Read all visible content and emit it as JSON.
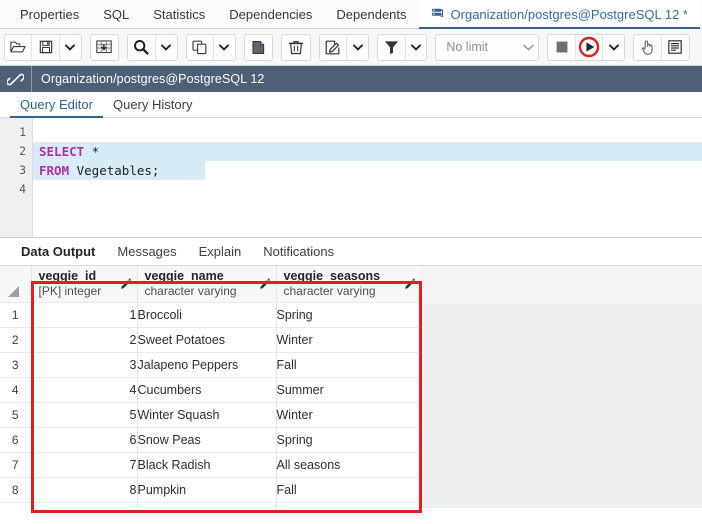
{
  "object_tabs": [
    {
      "label": "Properties",
      "icon": "",
      "active": false
    },
    {
      "label": "SQL",
      "icon": "",
      "active": false
    },
    {
      "label": "Statistics",
      "icon": "",
      "active": false
    },
    {
      "label": "Dependencies",
      "icon": "",
      "active": false
    },
    {
      "label": "Dependents",
      "icon": "",
      "active": false
    },
    {
      "label": "Organization/postgres@PostgreSQL 12 *",
      "icon": "database-icon",
      "active": true
    }
  ],
  "toolbar": {
    "groups": [
      {
        "buttons": [
          {
            "name": "open-file-button",
            "icon": "open-folder-icon",
            "title": "Open File"
          },
          {
            "name": "save-file-button",
            "icon": "save-floppy-icon",
            "title": "Save File"
          },
          {
            "name": "save-dropdown-button",
            "icon": "chevron-down-icon",
            "title": "Save options"
          }
        ]
      },
      {
        "buttons": [
          {
            "name": "edit-grid-button",
            "icon": "grid-download-icon",
            "title": "Edit grid"
          }
        ]
      },
      {
        "buttons": [
          {
            "name": "find-button",
            "icon": "search-icon",
            "title": "Find"
          },
          {
            "name": "find-dropdown-button",
            "icon": "chevron-down-icon",
            "title": "Find options"
          }
        ]
      },
      {
        "buttons": [
          {
            "name": "copy-button",
            "icon": "copy-icon",
            "title": "Copy"
          },
          {
            "name": "copy-dropdown-button",
            "icon": "chevron-down-icon",
            "title": "Copy options"
          }
        ]
      },
      {
        "buttons": [
          {
            "name": "paste-button",
            "icon": "paste-icon",
            "title": "Paste"
          }
        ]
      },
      {
        "buttons": [
          {
            "name": "delete-button",
            "icon": "trash-icon",
            "title": "Delete"
          }
        ]
      },
      {
        "buttons": [
          {
            "name": "edit-button",
            "icon": "pencil-square-icon",
            "title": "Edit"
          },
          {
            "name": "edit-dropdown-button",
            "icon": "chevron-down-icon",
            "title": "Edit options"
          }
        ]
      },
      {
        "buttons": [
          {
            "name": "filter-button",
            "icon": "funnel-icon",
            "title": "Filter"
          },
          {
            "name": "filter-dropdown-button",
            "icon": "chevron-down-icon",
            "title": "Filter options"
          }
        ]
      }
    ],
    "row_limit": {
      "label": "No limit",
      "icon": "chevron-down-icon"
    },
    "stop_button": {
      "name": "stop-query-button",
      "icon": "stop-square-icon"
    },
    "execute_button": {
      "name": "execute-query-button",
      "icon": "play-circle-icon",
      "accent": "#e02020"
    },
    "execute_dropdown": {
      "name": "execute-dropdown-button",
      "icon": "chevron-down-icon"
    },
    "macros_button": {
      "name": "macros-button",
      "icon": "hand-pointer-icon"
    },
    "panel_button": {
      "name": "panel-options-button",
      "icon": "list-panel-icon"
    }
  },
  "connection_bar": {
    "icon": "connection-link-icon",
    "title": "Organization/postgres@PostgreSQL 12"
  },
  "query_tabs": [
    {
      "label": "Query Editor",
      "active": true
    },
    {
      "label": "Query History",
      "active": false
    }
  ],
  "editor": {
    "line_numbers": [
      "1",
      "2",
      "3",
      "4"
    ],
    "lines": [
      {
        "num": "1",
        "tokens": [],
        "selected": false
      },
      {
        "num": "2",
        "tokens": [
          {
            "t": "SELECT",
            "kw": true
          },
          {
            "t": " *",
            "kw": false
          }
        ],
        "selected": true
      },
      {
        "num": "3",
        "tokens": [
          {
            "t": "FROM",
            "kw": true
          },
          {
            "t": " Vegetables;",
            "kw": false
          }
        ],
        "selected": true
      },
      {
        "num": "4",
        "tokens": [],
        "selected": false
      }
    ],
    "query_text": "SELECT *\nFROM Vegetables;"
  },
  "output_tabs": [
    {
      "label": "Data Output",
      "active": true
    },
    {
      "label": "Messages",
      "active": false
    },
    {
      "label": "Explain",
      "active": false
    },
    {
      "label": "Notifications",
      "active": false
    }
  ],
  "results": {
    "columns": [
      {
        "name": "veggie_id",
        "type": "[PK] integer",
        "align": "right",
        "edit_icon": "pencil-icon"
      },
      {
        "name": "veggie_name",
        "type": "character varying",
        "align": "left",
        "edit_icon": "pencil-icon"
      },
      {
        "name": "veggie_seasons",
        "type": "character varying",
        "align": "left",
        "edit_icon": "pencil-icon"
      }
    ],
    "rows": [
      {
        "n": "1",
        "veggie_id": "1",
        "veggie_name": "Broccoli",
        "veggie_seasons": "Spring"
      },
      {
        "n": "2",
        "veggie_id": "2",
        "veggie_name": "Sweet Potatoes",
        "veggie_seasons": "Winter"
      },
      {
        "n": "3",
        "veggie_id": "3",
        "veggie_name": "Jalapeno Peppers",
        "veggie_seasons": "Fall"
      },
      {
        "n": "4",
        "veggie_id": "4",
        "veggie_name": "Cucumbers",
        "veggie_seasons": "Summer"
      },
      {
        "n": "5",
        "veggie_id": "5",
        "veggie_name": "Winter Squash",
        "veggie_seasons": "Winter"
      },
      {
        "n": "6",
        "veggie_id": "6",
        "veggie_name": "Snow Peas",
        "veggie_seasons": "Spring"
      },
      {
        "n": "7",
        "veggie_id": "7",
        "veggie_name": "Black Radish",
        "veggie_seasons": "All seasons"
      },
      {
        "n": "8",
        "veggie_id": "8",
        "veggie_name": "Pumpkin",
        "veggie_seasons": "Fall"
      }
    ]
  },
  "annotation": {
    "color": "#e02020",
    "shape": "rectangle"
  }
}
